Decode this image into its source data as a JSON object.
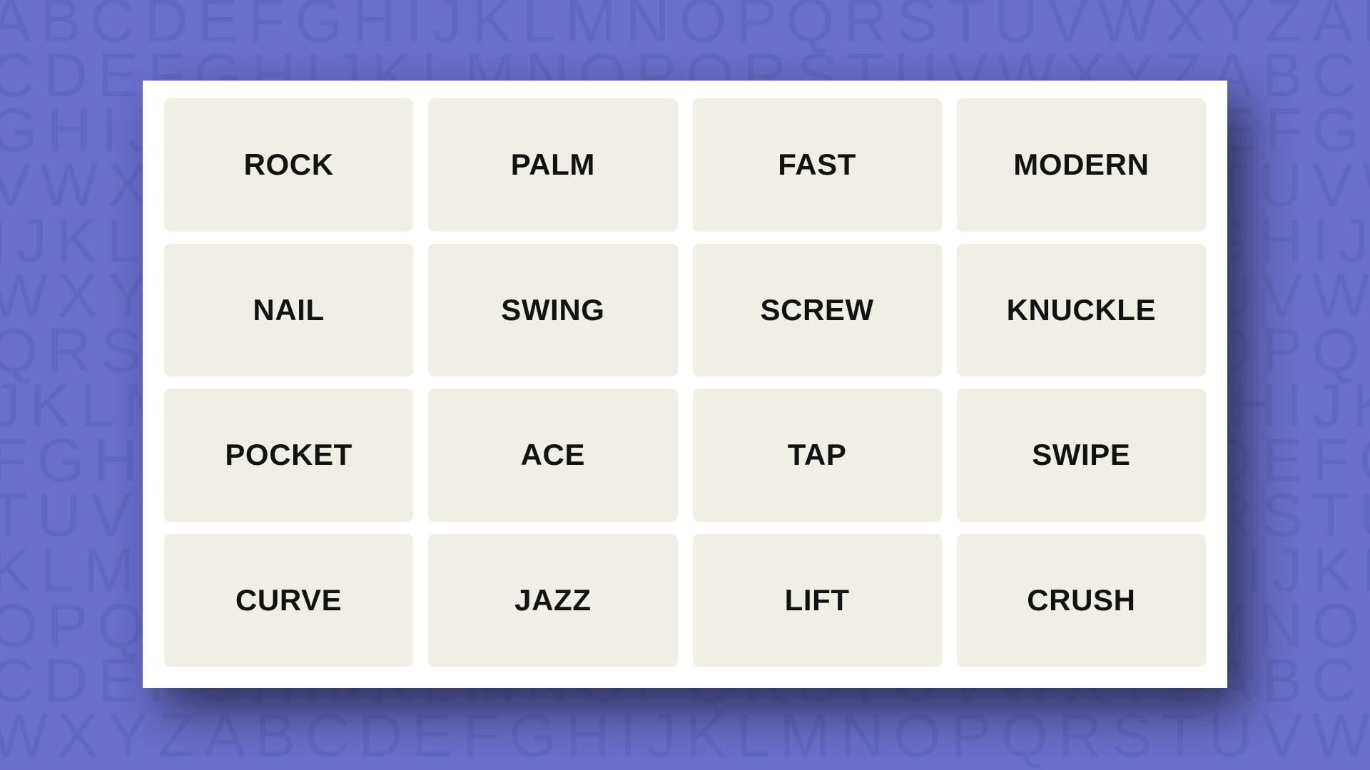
{
  "theme": {
    "background_color": "#6970CB",
    "background_letter_color": "#6069C2",
    "board_color": "#FFFFFF",
    "tile_color": "#EFEFE6",
    "tile_text_color": "#121212",
    "shadow_color": "#2A2B52"
  },
  "background": {
    "pattern_name": "alphabet-wallpaper",
    "rows": [
      "ABCDEFGHIJKLMNOPQRSTUVWXYZABCDEF",
      "CDEFGHIJKLMNOPQRSTUVWXYZABCDEFGH",
      "GHIJKLMNOPQRSTUVWXYZABCDEFGHIJKL",
      "VWXYZABCDEFGHIJKLMNOPQRSTUVWXYZA",
      "IJKLMNOPQRSTUVWXYZABCDEFGHIJKLMN",
      "WXYZABCDEFGHIJKLMNOPQRSTUVWXYZAB",
      "QRSTUVWXYZABCDEFGHIJKLMNOPQRSTUV",
      "JKLMNOPQRSTUVWXYZABCDEFGHIJKLMNO",
      "FGHIJKLMNOPQRSTUVWXYZABCDEFGHIJK",
      "TUVWXYZABCDEFGHIJKLMNOPQRSTUVWXY",
      "KLMNOPQRSTUVWXYZABCDEFGHIJKLMNOP",
      "OPQRSTUVWXYZABCDEFGHIJKLMNOPQRST",
      "CDEFGHIJKLMNOPQRSTUVWXYZABCDEFGH",
      "WXYZABCDEFGHIJKLMNOPQRSTUVWXYZAB"
    ]
  },
  "board": {
    "name": "word-association-puzzle-grid",
    "columns": 4,
    "rows": 4,
    "tiles": [
      {
        "label": "ROCK",
        "row": 1,
        "col": 1,
        "selected": false
      },
      {
        "label": "PALM",
        "row": 1,
        "col": 2,
        "selected": false
      },
      {
        "label": "FAST",
        "row": 1,
        "col": 3,
        "selected": false
      },
      {
        "label": "MODERN",
        "row": 1,
        "col": 4,
        "selected": false
      },
      {
        "label": "NAIL",
        "row": 2,
        "col": 1,
        "selected": false
      },
      {
        "label": "SWING",
        "row": 2,
        "col": 2,
        "selected": false
      },
      {
        "label": "SCREW",
        "row": 2,
        "col": 3,
        "selected": false
      },
      {
        "label": "KNUCKLE",
        "row": 2,
        "col": 4,
        "selected": false
      },
      {
        "label": "POCKET",
        "row": 3,
        "col": 1,
        "selected": false
      },
      {
        "label": "ACE",
        "row": 3,
        "col": 2,
        "selected": false
      },
      {
        "label": "TAP",
        "row": 3,
        "col": 3,
        "selected": false
      },
      {
        "label": "SWIPE",
        "row": 3,
        "col": 4,
        "selected": false
      },
      {
        "label": "CURVE",
        "row": 4,
        "col": 1,
        "selected": false
      },
      {
        "label": "JAZZ",
        "row": 4,
        "col": 2,
        "selected": false
      },
      {
        "label": "LIFT",
        "row": 4,
        "col": 3,
        "selected": false
      },
      {
        "label": "CRUSH",
        "row": 4,
        "col": 4,
        "selected": false
      }
    ]
  }
}
